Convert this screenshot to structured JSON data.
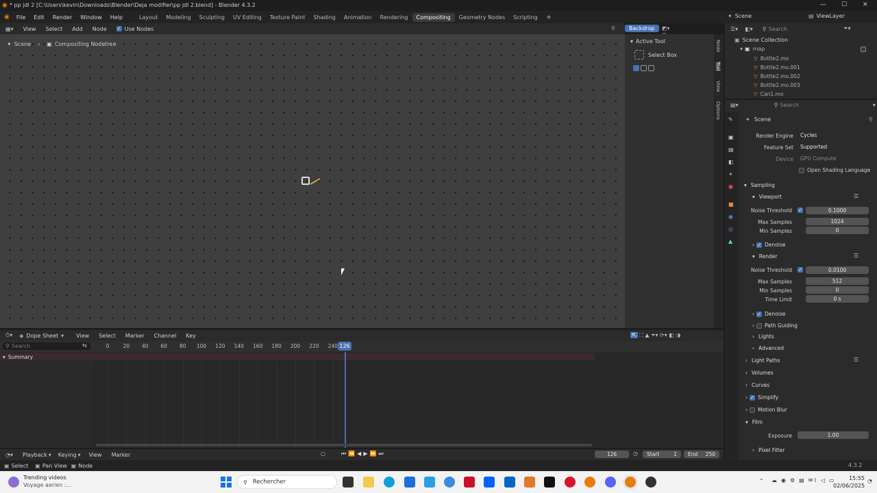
{
  "window": {
    "title": "* pp jdl 2 [C:\\Users\\kevin\\Downloads\\Blender\\Deja modifier\\pp jdl 2.blend] - Blender 4.3.2"
  },
  "menu": [
    "File",
    "Edit",
    "Render",
    "Window",
    "Help"
  ],
  "workspaces": [
    "Layout",
    "Modeling",
    "Sculpting",
    "UV Editing",
    "Texture Paint",
    "Shading",
    "Animation",
    "Rendering",
    "Compositing",
    "Geometry Nodes",
    "Scripting"
  ],
  "active_workspace": "Compositing",
  "scene": "Scene",
  "view_layer": "ViewLayer",
  "node_editor": {
    "menu": [
      "View",
      "Select",
      "Add",
      "Node"
    ],
    "use_nodes": "Use Nodes",
    "backdrop": "Backdrop",
    "breadcrumb": [
      "Scene",
      "Compositing Nodetree"
    ],
    "vtabs": [
      "Node",
      "Tool",
      "View",
      "Options"
    ]
  },
  "tool_panel": {
    "title": "Active Tool",
    "tool": "Select Box"
  },
  "outliner": {
    "search": "Search",
    "root": "Scene Collection",
    "collection": "map",
    "items": [
      "Bottle2.mo",
      "Bottle2.mo.001",
      "Bottle2.mo.002",
      "Bottle2.mo.003",
      "Can1.mo"
    ]
  },
  "properties": {
    "search": "Search",
    "scene": "Scene",
    "render_engine_label": "Render Engine",
    "render_engine": "Cycles",
    "feature_set_label": "Feature Set",
    "feature_set": "Supported",
    "device_label": "Device",
    "device": "GPU Compute",
    "osl": "Open Shading Language",
    "sampling": "Sampling",
    "viewport": "Viewport",
    "vp_noise_label": "Noise Threshold",
    "vp_noise": "0.1000",
    "vp_max_label": "Max Samples",
    "vp_max": "1024",
    "vp_min_label": "Min Samples",
    "vp_min": "0",
    "vp_denoise": "Denoise",
    "render": "Render",
    "r_noise_label": "Noise Threshold",
    "r_noise": "0.0100",
    "r_max_label": "Max Samples",
    "r_max": "512",
    "r_min_label": "Min Samples",
    "r_min": "0",
    "r_time_label": "Time Limit",
    "r_time": "0 s",
    "r_denoise": "Denoise",
    "path_guiding": "Path Guiding",
    "lights": "Lights",
    "advanced": "Advanced",
    "light_paths": "Light Paths",
    "volumes": "Volumes",
    "curves": "Curves",
    "simplify": "Simplify",
    "motion_blur": "Motion Blur",
    "film": "Film",
    "exposure_label": "Exposure",
    "exposure": "1.00",
    "pixel_filter": "Pixel Filter"
  },
  "dopesheet": {
    "mode": "Dope Sheet",
    "menu": [
      "View",
      "Select",
      "Marker",
      "Channel",
      "Key"
    ],
    "search": "Search",
    "summary": "Summary",
    "ticks": [
      "0",
      "20",
      "40",
      "60",
      "80",
      "100",
      "120",
      "140",
      "160",
      "180",
      "200",
      "220",
      "240"
    ],
    "current_frame": "126"
  },
  "playback": {
    "menu": [
      "Playback",
      "Keying",
      "View",
      "Marker"
    ],
    "frame": "126",
    "start_label": "Start",
    "start": "1",
    "end_label": "End",
    "end": "250"
  },
  "statusbar": {
    "select": "Select",
    "pan": "Pan View",
    "node": "Node",
    "version": "4.3.2"
  },
  "taskbar": {
    "news_title": "Trending videos",
    "news_sub": "Voyage aerien :...",
    "search": "Rechercher",
    "time": "15:55",
    "date": "02/06/2025"
  },
  "colors": {
    "accent": "#4772b3",
    "playhead": "#4772b3"
  }
}
